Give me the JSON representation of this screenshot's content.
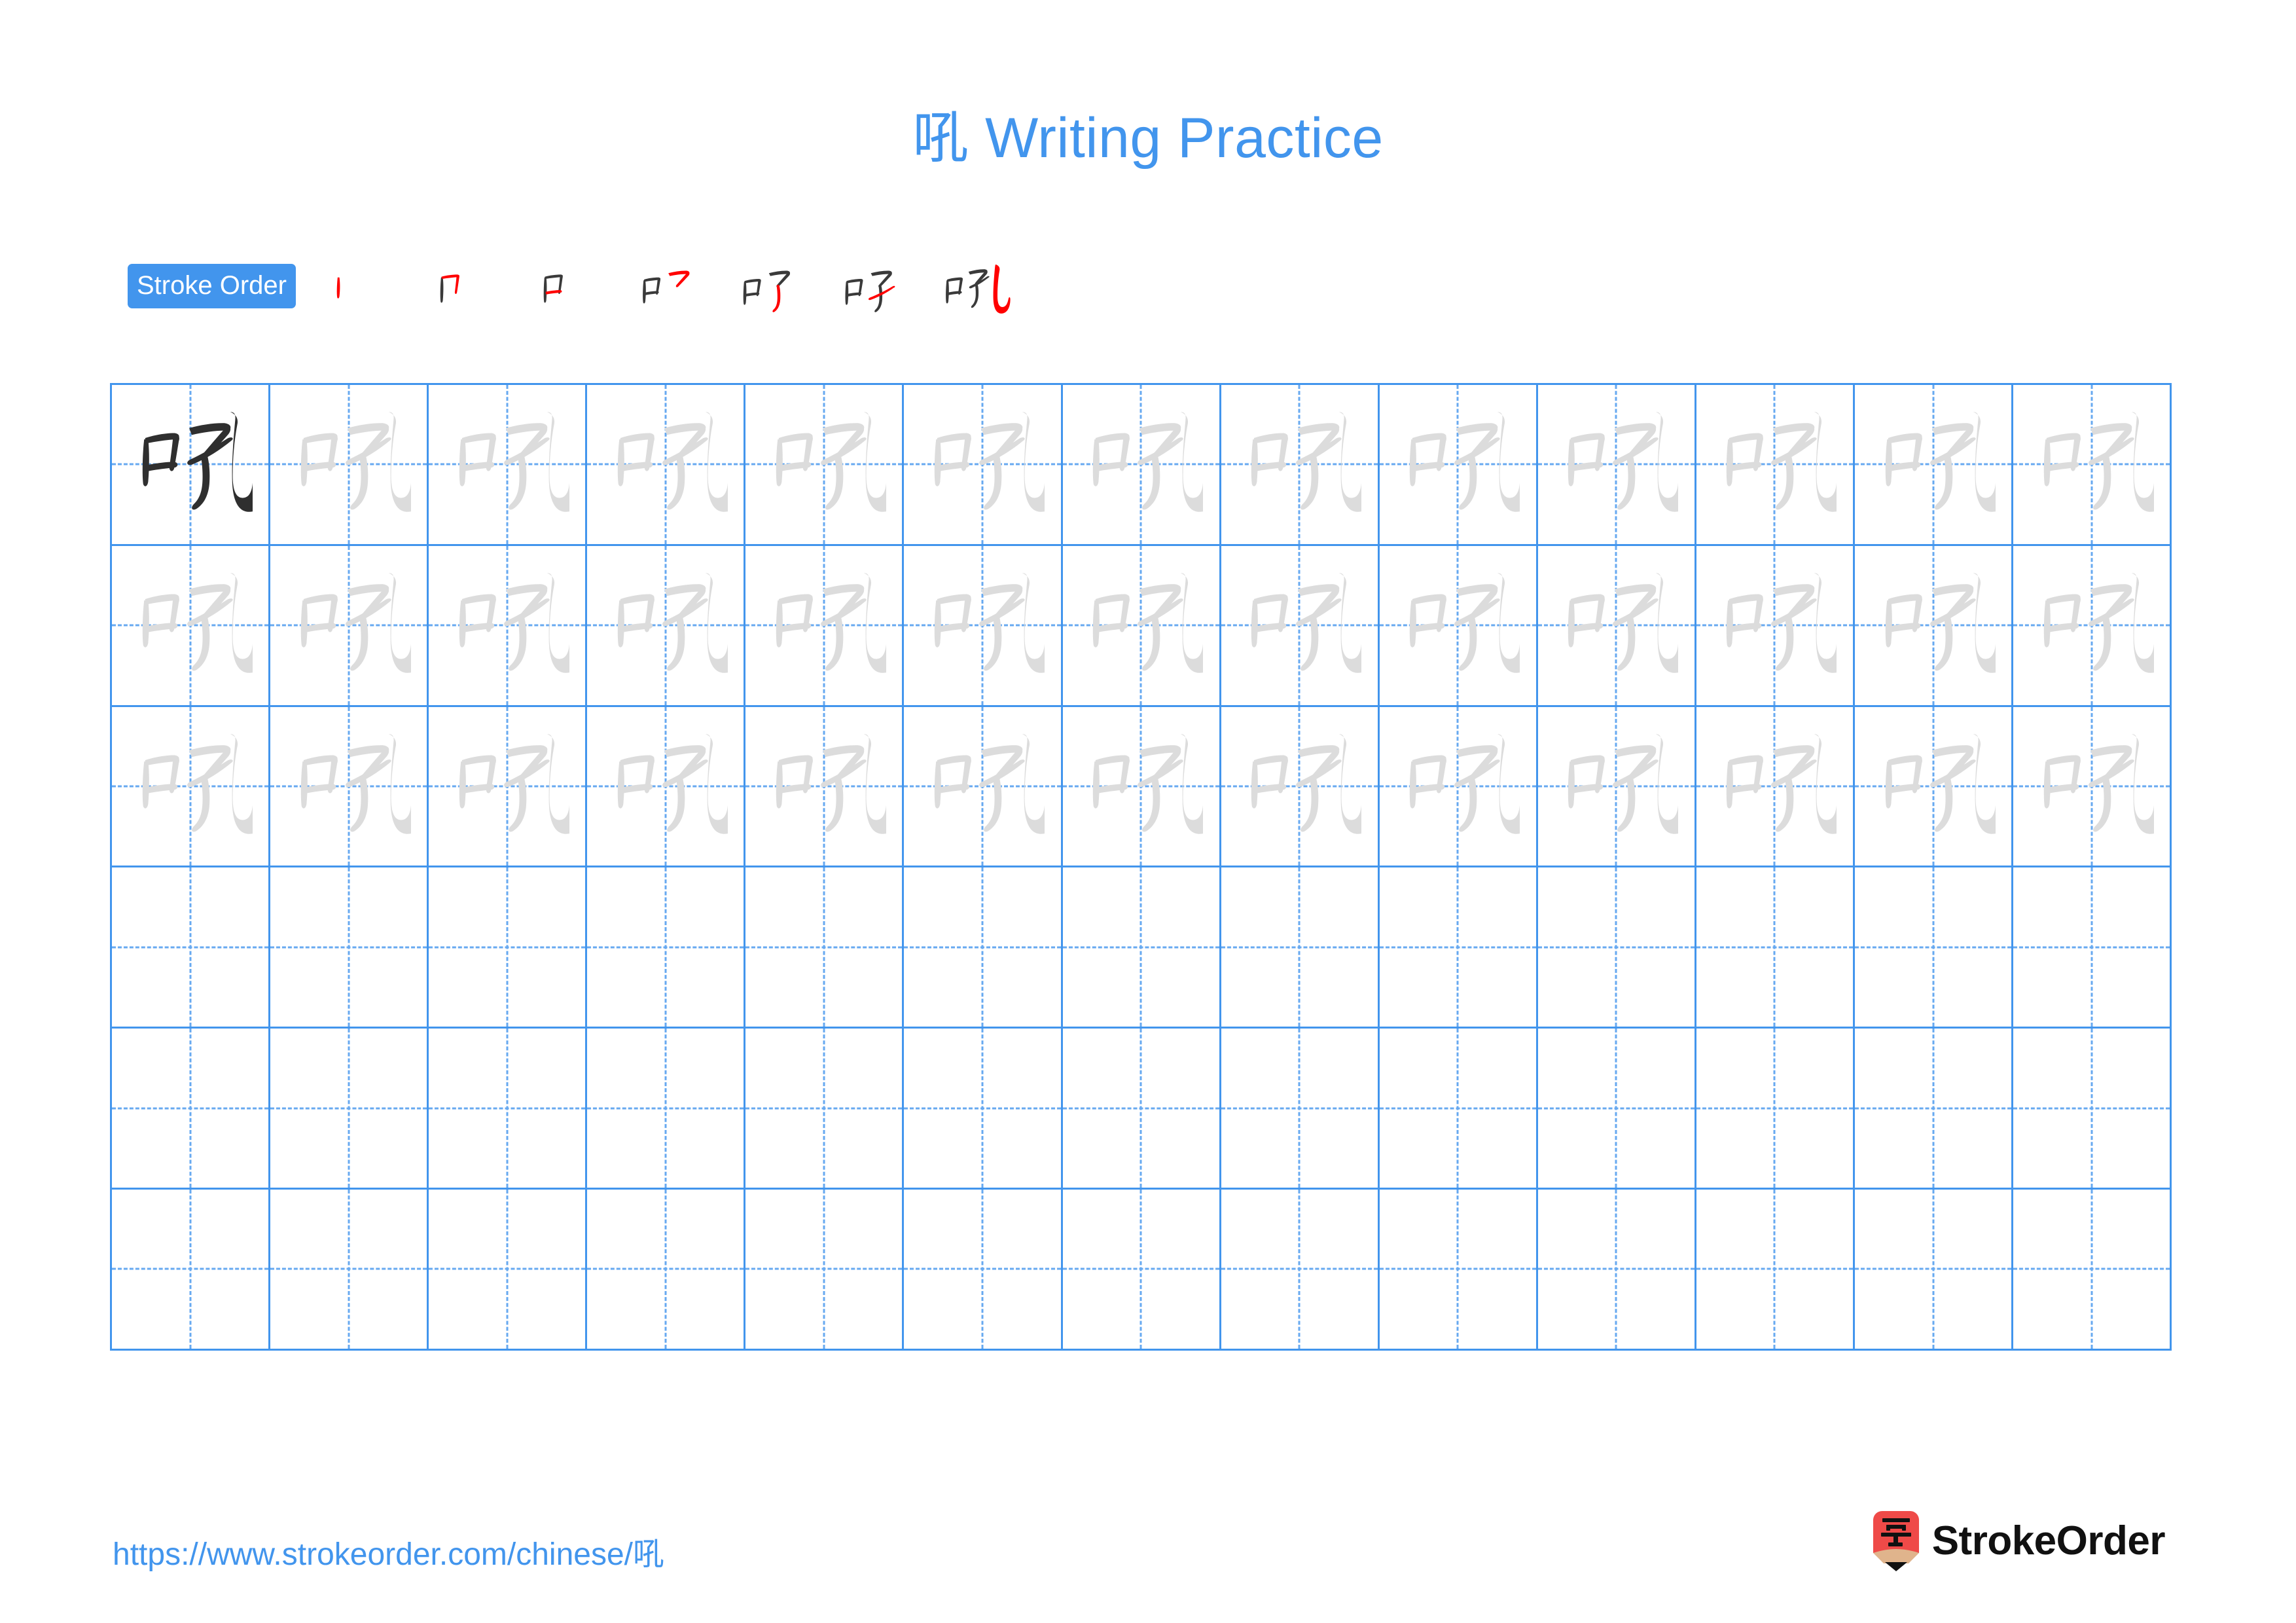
{
  "meta": {
    "character": "吼",
    "page_background": "#ffffff"
  },
  "colors": {
    "accent_blue": "#4295ed",
    "grid_line_blue": "#4295ed",
    "grid_dash_blue": "#67a9f0",
    "ghost_glyph_grey": "#dcdcdc",
    "dark_glyph": "#2f2f2f",
    "stroke_new_red": "#ff0000",
    "stroke_done_black": "#3a3a3a",
    "logo_red": "#ef4a48",
    "logo_wood": "#e0b48c",
    "logo_text_black": "#111111"
  },
  "header": {
    "title_character": "吼",
    "title_text": " Writing Practice"
  },
  "stroke_order": {
    "badge_label": "Stroke Order",
    "step_count": 7,
    "steps": [
      {
        "index": 1,
        "label": "stroke-1",
        "strokes_drawn": 1
      },
      {
        "index": 2,
        "label": "stroke-2",
        "strokes_drawn": 2
      },
      {
        "index": 3,
        "label": "stroke-3",
        "strokes_drawn": 3
      },
      {
        "index": 4,
        "label": "stroke-4",
        "strokes_drawn": 4
      },
      {
        "index": 5,
        "label": "stroke-5",
        "strokes_drawn": 5
      },
      {
        "index": 6,
        "label": "stroke-6",
        "strokes_drawn": 6
      },
      {
        "index": 7,
        "label": "stroke-7",
        "strokes_drawn": 7
      }
    ]
  },
  "practice_grid": {
    "columns": 13,
    "rows": 6,
    "cells": [
      [
        "dark",
        "ghost",
        "ghost",
        "ghost",
        "ghost",
        "ghost",
        "ghost",
        "ghost",
        "ghost",
        "ghost",
        "ghost",
        "ghost",
        "ghost"
      ],
      [
        "ghost",
        "ghost",
        "ghost",
        "ghost",
        "ghost",
        "ghost",
        "ghost",
        "ghost",
        "ghost",
        "ghost",
        "ghost",
        "ghost",
        "ghost"
      ],
      [
        "ghost",
        "ghost",
        "ghost",
        "ghost",
        "ghost",
        "ghost",
        "ghost",
        "ghost",
        "ghost",
        "ghost",
        "ghost",
        "ghost",
        "ghost"
      ],
      [
        "empty",
        "empty",
        "empty",
        "empty",
        "empty",
        "empty",
        "empty",
        "empty",
        "empty",
        "empty",
        "empty",
        "empty",
        "empty"
      ],
      [
        "empty",
        "empty",
        "empty",
        "empty",
        "empty",
        "empty",
        "empty",
        "empty",
        "empty",
        "empty",
        "empty",
        "empty",
        "empty"
      ],
      [
        "empty",
        "empty",
        "empty",
        "empty",
        "empty",
        "empty",
        "empty",
        "empty",
        "empty",
        "empty",
        "empty",
        "empty",
        "empty"
      ]
    ]
  },
  "footer": {
    "url_prefix": "https://www.strokeorder.com/chinese/",
    "url_character": "吼",
    "brand_name": "StrokeOrder",
    "brand_mark_character": "字"
  }
}
